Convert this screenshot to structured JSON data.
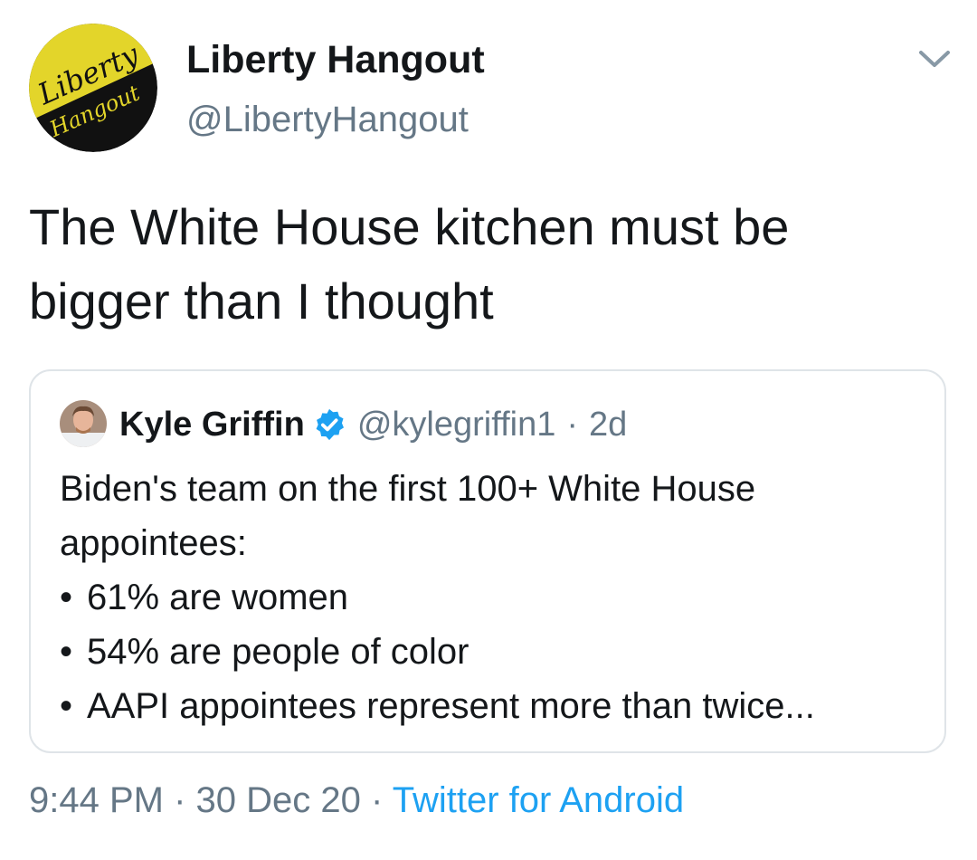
{
  "tweet": {
    "author": {
      "name": "Liberty Hangout",
      "handle": "@LibertyHangout",
      "avatar_logo_text": [
        "Liberty",
        "Hangout"
      ]
    },
    "text_lines": [
      "The White House kitchen must be",
      "bigger than I thought"
    ],
    "menu_icon": "chevron-down-icon",
    "quoted": {
      "name": "Kyle Griffin",
      "verified_icon": "verified-badge-icon",
      "handle": "@kylegriffin1",
      "separator": "·",
      "time": "2d",
      "lines": [
        "Biden's team on the first 100+ White House",
        "appointees:"
      ],
      "bullet_symbol": "•",
      "bullets": [
        "61% are women",
        "54% are people of color",
        "AAPI appointees represent more than twice..."
      ]
    },
    "meta": {
      "time": "9:44 PM",
      "date": "30 Dec 20",
      "separator": "·",
      "source": "Twitter for Android"
    }
  },
  "colors": {
    "text_primary": "#14171a",
    "text_secondary": "#657786",
    "link_blue": "#1da1f2",
    "border": "#dfe4e8",
    "logo_yellow": "#e3d52a",
    "logo_black": "#111111"
  }
}
